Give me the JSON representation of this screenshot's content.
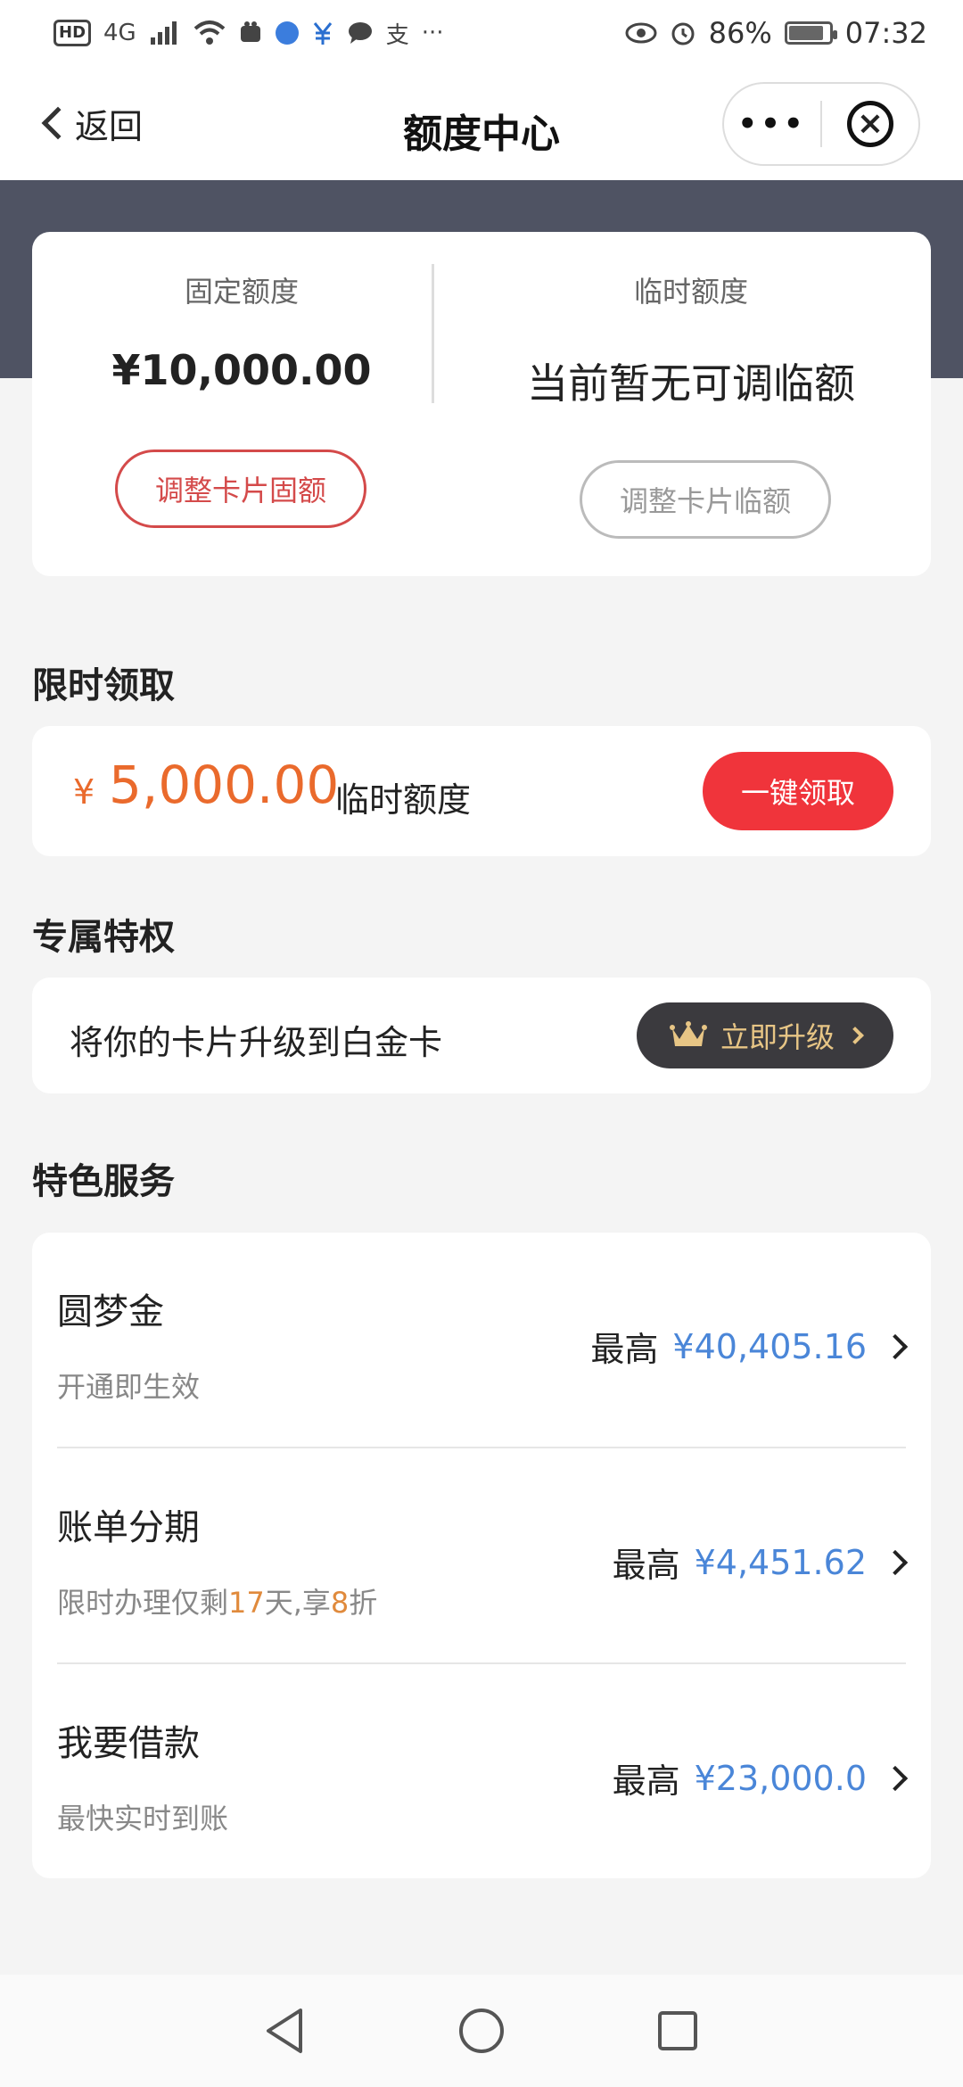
{
  "status_bar": {
    "network_label": "HD",
    "signal_label": "4G",
    "more_label": "···",
    "battery_percent": "86%",
    "time": "07:32",
    "battery_level": 0.86
  },
  "nav": {
    "back_label": "返回",
    "title": "额度中心",
    "more_label": "•••",
    "close_label": "×"
  },
  "quota": {
    "fixed_label": "固定额度",
    "fixed_amount": "¥10,000.00",
    "fixed_button": "调整卡片固额",
    "temp_label": "临时额度",
    "temp_status": "当前暂无可调临额",
    "temp_button": "调整卡片临额"
  },
  "limited": {
    "section_title": "限时领取",
    "currency": "¥",
    "amount": "5,000.00",
    "suffix": "临时额度",
    "button": "一键领取"
  },
  "privilege": {
    "section_title": "专属特权",
    "text": "将你的卡片升级到白金卡",
    "button": "立即升级"
  },
  "services": {
    "section_title": "特色服务",
    "items": [
      {
        "name": "圆梦金",
        "desc": "开通即生效",
        "prefix": "最高",
        "value": "¥40,405.16"
      },
      {
        "name": "账单分期",
        "desc_before": "限时办理仅剩",
        "desc_days": "17",
        "desc_mid": "天,享",
        "desc_discount": "8",
        "desc_after": "折",
        "prefix": "最高",
        "value": "¥4,451.62"
      },
      {
        "name": "我要借款",
        "desc": "最快实时到账",
        "prefix": "最高",
        "value": "¥23,000.0"
      }
    ]
  },
  "colors": {
    "accent_red": "#f0343b",
    "amount_orange": "#ea6a2c",
    "value_blue": "#4a86d8",
    "header_band": "#4f5363",
    "gold": "#e7c585"
  }
}
